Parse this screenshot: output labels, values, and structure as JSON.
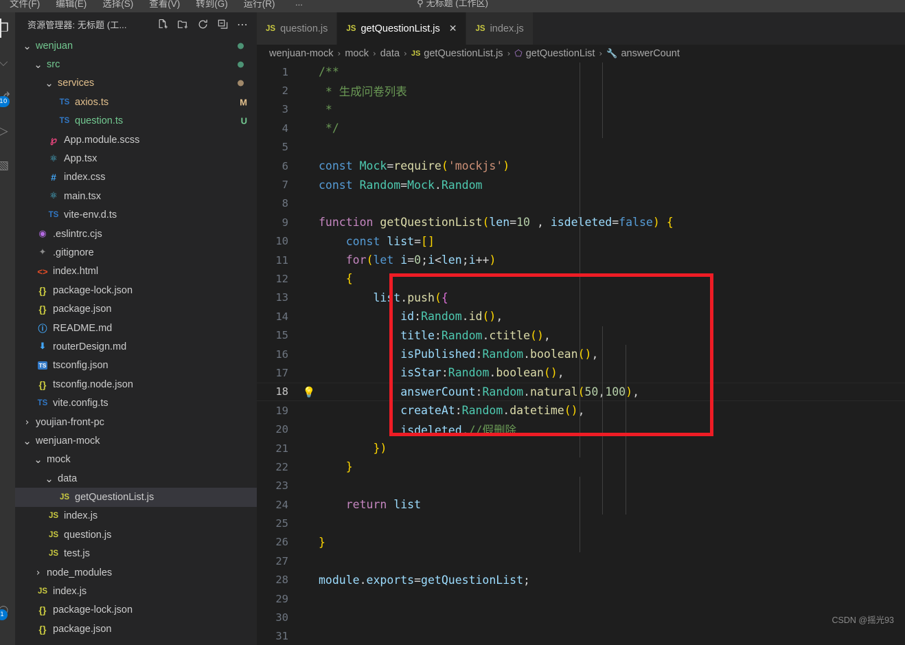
{
  "titlebar": {
    "menus": [
      "文件(F)",
      "编辑(E)",
      "选择(S)",
      "查看(V)",
      "转到(G)",
      "运行(R)"
    ],
    "overflow": "...",
    "search_icon": "search-icon",
    "window_title": "无标题 (工作区)"
  },
  "activitybar": {
    "items": [
      {
        "name": "explorer",
        "glyph": "❐",
        "active": true,
        "badge": ""
      },
      {
        "name": "search",
        "glyph": "⌕",
        "active": false,
        "badge": ""
      },
      {
        "name": "source-control",
        "glyph": "⎇",
        "active": false,
        "badge": "10"
      },
      {
        "name": "run-and-debug",
        "glyph": "▷",
        "active": false,
        "badge": ""
      },
      {
        "name": "extensions",
        "glyph": "▣",
        "active": false,
        "badge": ""
      },
      {
        "name": "accounts",
        "glyph": "○",
        "active": false,
        "badge": "1"
      }
    ]
  },
  "sidebar": {
    "title": "资源管理器: 无标题 (工...",
    "actions": [
      {
        "name": "new-file-icon",
        "tooltip": "新建文件"
      },
      {
        "name": "new-folder-icon",
        "tooltip": "新建文件夹"
      },
      {
        "name": "refresh-icon",
        "tooltip": "刷新资源管理器"
      },
      {
        "name": "collapse-all-icon",
        "tooltip": "在资源管理器中折叠文件夹"
      },
      {
        "name": "more-actions-icon",
        "tooltip": "视图和更多操作..."
      }
    ],
    "tree": [
      {
        "label": "wenjuan",
        "indent": 0,
        "kind": "folder",
        "expanded": true,
        "icon": "chevron-down",
        "color": "#73c991",
        "dot": "#4d9375"
      },
      {
        "label": "src",
        "indent": 1,
        "kind": "folder",
        "expanded": true,
        "icon": "chevron-down",
        "color": "#73c991",
        "dot": "#4d9375"
      },
      {
        "label": "services",
        "indent": 2,
        "kind": "folder",
        "expanded": true,
        "icon": "chevron-down",
        "color": "#e2c08d",
        "dot": "#a1896a"
      },
      {
        "label": "axios.ts",
        "indent": 3,
        "kind": "file",
        "icon": "ts",
        "color": "#e2c08d",
        "badge": "M",
        "badgeColor": "#e2c08d"
      },
      {
        "label": "question.ts",
        "indent": 3,
        "kind": "file",
        "icon": "ts",
        "color": "#73c991",
        "badge": "U",
        "badgeColor": "#73c991"
      },
      {
        "label": "App.module.scss",
        "indent": 2,
        "kind": "file",
        "icon": "scss",
        "color": "#cccccc"
      },
      {
        "label": "App.tsx",
        "indent": 2,
        "kind": "file",
        "icon": "react",
        "color": "#cccccc"
      },
      {
        "label": "index.css",
        "indent": 2,
        "kind": "file",
        "icon": "css",
        "color": "#cccccc"
      },
      {
        "label": "main.tsx",
        "indent": 2,
        "kind": "file",
        "icon": "react",
        "color": "#cccccc"
      },
      {
        "label": "vite-env.d.ts",
        "indent": 2,
        "kind": "file",
        "icon": "ts",
        "color": "#cccccc"
      },
      {
        "label": ".eslintrc.cjs",
        "indent": 1,
        "kind": "file",
        "icon": "eslint",
        "color": "#cccccc"
      },
      {
        "label": ".gitignore",
        "indent": 1,
        "kind": "file",
        "icon": "git",
        "color": "#cccccc"
      },
      {
        "label": "index.html",
        "indent": 1,
        "kind": "file",
        "icon": "html",
        "color": "#cccccc"
      },
      {
        "label": "package-lock.json",
        "indent": 1,
        "kind": "file",
        "icon": "json",
        "color": "#cccccc"
      },
      {
        "label": "package.json",
        "indent": 1,
        "kind": "file",
        "icon": "json",
        "color": "#cccccc"
      },
      {
        "label": "README.md",
        "indent": 1,
        "kind": "file",
        "icon": "info",
        "color": "#cccccc"
      },
      {
        "label": "routerDesign.md",
        "indent": 1,
        "kind": "file",
        "icon": "md",
        "color": "#cccccc"
      },
      {
        "label": "tsconfig.json",
        "indent": 1,
        "kind": "file",
        "icon": "tsconf",
        "color": "#cccccc"
      },
      {
        "label": "tsconfig.node.json",
        "indent": 1,
        "kind": "file",
        "icon": "json",
        "color": "#cccccc"
      },
      {
        "label": "vite.config.ts",
        "indent": 1,
        "kind": "file",
        "icon": "ts",
        "color": "#cccccc"
      },
      {
        "label": "youjian-front-pc",
        "indent": 0,
        "kind": "folder",
        "expanded": false,
        "icon": "chevron-right",
        "color": "#cccccc"
      },
      {
        "label": "wenjuan-mock",
        "indent": 0,
        "kind": "folder",
        "expanded": true,
        "icon": "chevron-down",
        "color": "#cccccc"
      },
      {
        "label": "mock",
        "indent": 1,
        "kind": "folder",
        "expanded": true,
        "icon": "chevron-down",
        "color": "#cccccc"
      },
      {
        "label": "data",
        "indent": 2,
        "kind": "folder",
        "expanded": true,
        "icon": "chevron-down",
        "color": "#cccccc"
      },
      {
        "label": "getQuestionList.js",
        "indent": 3,
        "kind": "file",
        "icon": "js",
        "color": "#cccccc",
        "selected": true
      },
      {
        "label": "index.js",
        "indent": 2,
        "kind": "file",
        "icon": "js",
        "color": "#cccccc"
      },
      {
        "label": "question.js",
        "indent": 2,
        "kind": "file",
        "icon": "js",
        "color": "#cccccc"
      },
      {
        "label": "test.js",
        "indent": 2,
        "kind": "file",
        "icon": "js",
        "color": "#cccccc"
      },
      {
        "label": "node_modules",
        "indent": 1,
        "kind": "folder",
        "expanded": false,
        "icon": "chevron-right",
        "color": "#cccccc"
      },
      {
        "label": "index.js",
        "indent": 1,
        "kind": "file",
        "icon": "js",
        "color": "#cccccc"
      },
      {
        "label": "package-lock.json",
        "indent": 1,
        "kind": "file",
        "icon": "json",
        "color": "#cccccc"
      },
      {
        "label": "package.json",
        "indent": 1,
        "kind": "file",
        "icon": "json",
        "color": "#cccccc"
      }
    ]
  },
  "editor": {
    "tabs": [
      {
        "label": "question.js",
        "icon": "js",
        "active": false,
        "closable": false
      },
      {
        "label": "getQuestionList.js",
        "icon": "js",
        "active": true,
        "closable": true,
        "close_glyph": "✕"
      },
      {
        "label": "index.js",
        "icon": "js",
        "active": false,
        "closable": false
      }
    ],
    "breadcrumb": [
      {
        "label": "wenjuan-mock",
        "icon": ""
      },
      {
        "label": "mock",
        "icon": ""
      },
      {
        "label": "data",
        "icon": ""
      },
      {
        "label": "getQuestionList.js",
        "icon": "js"
      },
      {
        "label": "getQuestionList",
        "icon": "symbol-cube"
      },
      {
        "label": "answerCount",
        "icon": "symbol-wrench"
      }
    ],
    "breadcrumb_separator": "›",
    "current_line": 18,
    "lightbulb_line": 18,
    "lines": [
      {
        "n": 1,
        "text": "/**"
      },
      {
        "n": 2,
        "text": " * 生成问卷列表"
      },
      {
        "n": 3,
        "text": " *"
      },
      {
        "n": 4,
        "text": " */"
      },
      {
        "n": 5,
        "text": ""
      },
      {
        "n": 6,
        "text": "const Mock=require('mockjs')"
      },
      {
        "n": 7,
        "text": "const Random=Mock.Random"
      },
      {
        "n": 8,
        "text": ""
      },
      {
        "n": 9,
        "text": "function getQuestionList(len=10 , isdeleted=false) {"
      },
      {
        "n": 10,
        "text": "    const list=[]"
      },
      {
        "n": 11,
        "text": "    for(let i=0;i<len;i++)"
      },
      {
        "n": 12,
        "text": "    {"
      },
      {
        "n": 13,
        "text": "        list.push({"
      },
      {
        "n": 14,
        "text": "            id:Random.id(),"
      },
      {
        "n": 15,
        "text": "            title:Random.ctitle(),"
      },
      {
        "n": 16,
        "text": "            isPublished:Random.boolean(),"
      },
      {
        "n": 17,
        "text": "            isStar:Random.boolean(),"
      },
      {
        "n": 18,
        "text": "            answerCount:Random.natural(50,100),"
      },
      {
        "n": 19,
        "text": "            createAt:Random.datetime(),"
      },
      {
        "n": 20,
        "text": "            isdeleted,//假删除"
      },
      {
        "n": 21,
        "text": "        })"
      },
      {
        "n": 22,
        "text": "    }"
      },
      {
        "n": 23,
        "text": ""
      },
      {
        "n": 24,
        "text": "    return list"
      },
      {
        "n": 25,
        "text": ""
      },
      {
        "n": 26,
        "text": "}"
      },
      {
        "n": 27,
        "text": ""
      },
      {
        "n": 28,
        "text": "module.exports=getQuestionList;"
      },
      {
        "n": 29,
        "text": ""
      },
      {
        "n": 30,
        "text": ""
      },
      {
        "n": 31,
        "text": ""
      }
    ],
    "annotation": {
      "name": "red-highlight-box",
      "color": "#ee1c25",
      "covers_lines": "13-21"
    },
    "watermark": "CSDN @摇光93"
  },
  "colors": {
    "editor_bg": "#1e1e1e",
    "sidebar_bg": "#252526",
    "activitybar_bg": "#333333",
    "titlebar_bg": "#3c3c3c",
    "accent": "#0078d4",
    "annotation_red": "#ee1c25",
    "selection_bg": "#37373d"
  }
}
